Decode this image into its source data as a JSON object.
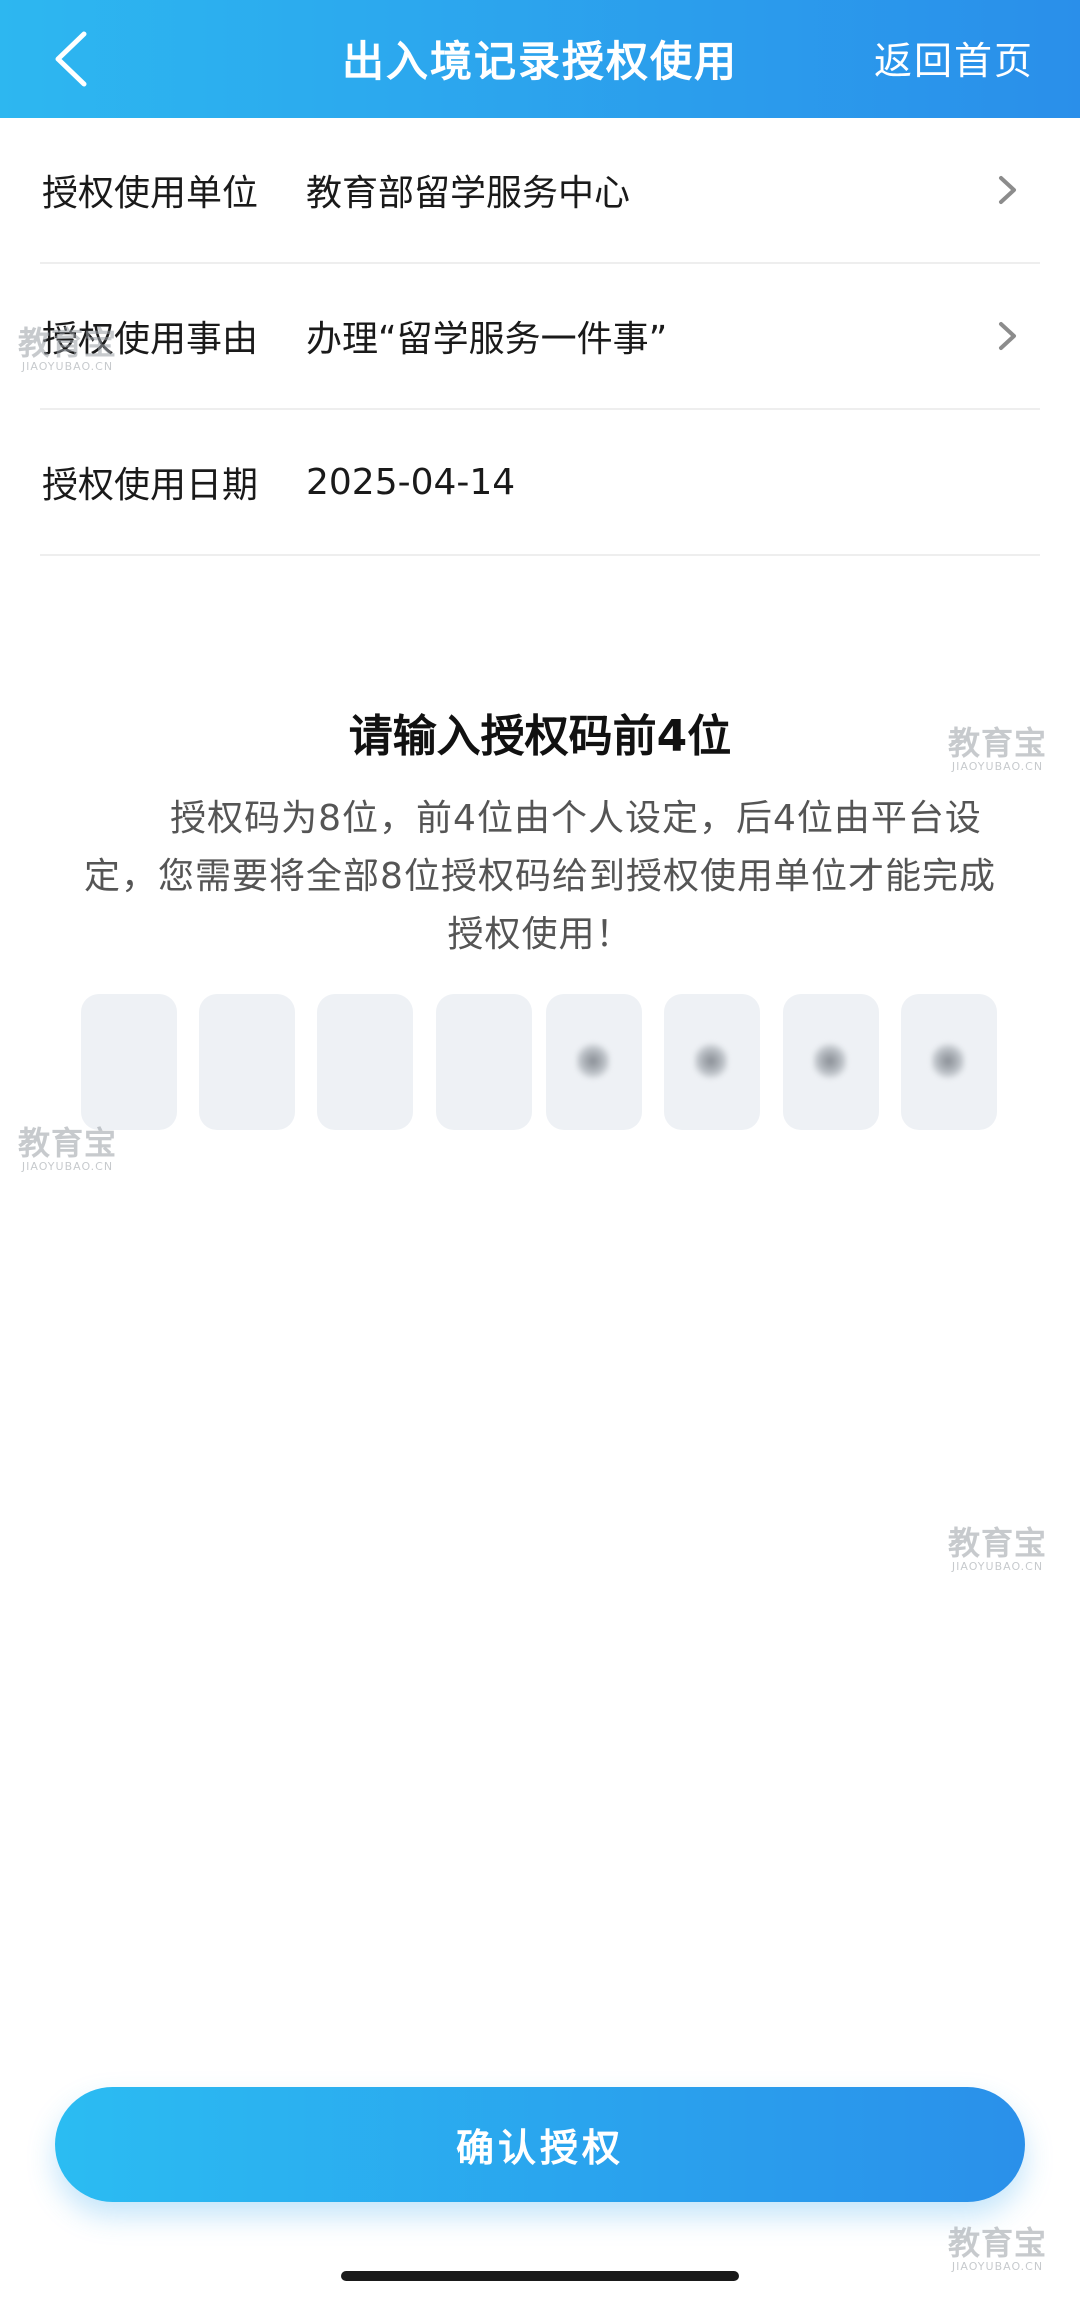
{
  "header": {
    "title": "出入境记录授权使用",
    "home_label": "返回首页",
    "back_icon": "chevron-left-icon"
  },
  "info_rows": [
    {
      "label": "授权使用单位",
      "value": "教育部留学服务中心",
      "has_chevron": true
    },
    {
      "label": "授权使用事由",
      "value": "办理“留学服务一件事”",
      "has_chevron": true
    },
    {
      "label": "授权使用日期",
      "value": "2025-04-14",
      "has_chevron": false
    }
  ],
  "code_section": {
    "title": "请输入授权码前4位",
    "description_line1": "授权码为8位，前4位由个人设定，后4位由平台设",
    "description_line2": "定，您需要将全部8位授权码给到授权使用单位才能完成",
    "description_line3": "授权使用！",
    "digit_count": 8,
    "user_digits_count": 4,
    "platform_digits_obscured": true
  },
  "confirm_button": {
    "label": "确认授权"
  },
  "watermark": {
    "cn": "教育宝",
    "en": "JIAOYUBAO.CN"
  },
  "colors": {
    "header_gradient_start": "#2db7f0",
    "header_gradient_end": "#2a8fea",
    "code_box_bg": "#eef1f5",
    "button_gradient_start": "#2bbcf2",
    "button_gradient_end": "#2a90ea"
  }
}
